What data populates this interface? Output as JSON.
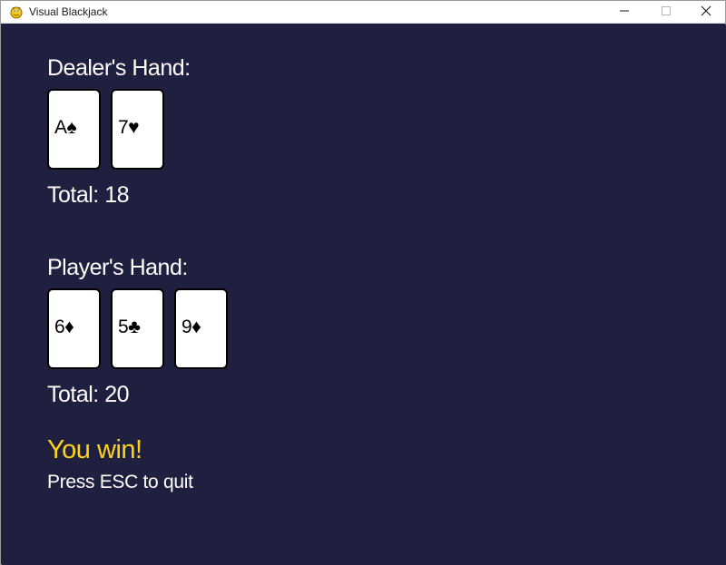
{
  "window": {
    "title": "Visual Blackjack",
    "icon": "pygame-snake-icon",
    "controls": [
      "minimize-icon",
      "maximize-icon",
      "close-icon"
    ]
  },
  "colors": {
    "background": "#1f1f3f",
    "text": "#ffffff",
    "win": "#ffd21a",
    "card_face": "#ffffff",
    "card_border": "#000000"
  },
  "dealer": {
    "heading": "Dealer's Hand:",
    "cards": [
      {
        "text": "A♠"
      },
      {
        "text": "7♥"
      }
    ],
    "total_text": "Total: 18"
  },
  "player": {
    "heading": "Player's Hand:",
    "cards": [
      {
        "text": "6♦"
      },
      {
        "text": "5♣"
      },
      {
        "text": "9♦"
      }
    ],
    "total_text": "Total: 20"
  },
  "result": {
    "message": "You win!",
    "hint": "Press ESC to quit"
  }
}
